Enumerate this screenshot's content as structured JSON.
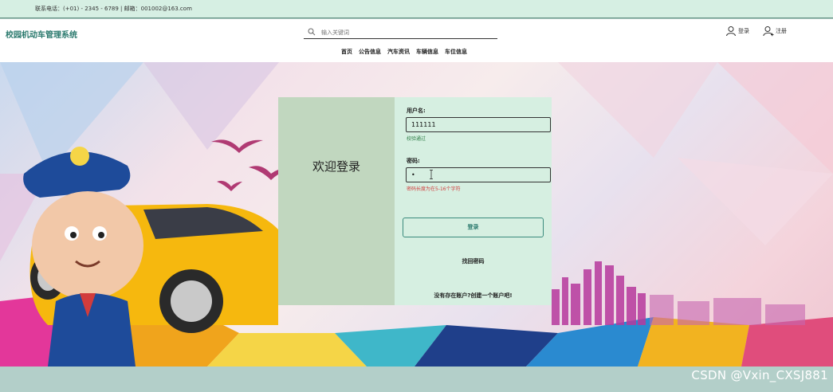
{
  "topbar": {
    "contact": "联系电话：(+01) - 2345 - 6789 | 邮箱：001002@163.com"
  },
  "header": {
    "brand": "校园机动车管理系统",
    "search_placeholder": "输入关键词",
    "login_label": "登录",
    "register_label": "注册"
  },
  "nav": {
    "items": [
      {
        "label": "首页"
      },
      {
        "label": "公告信息"
      },
      {
        "label": "汽车资讯"
      },
      {
        "label": "车辆信息"
      },
      {
        "label": "车位信息"
      }
    ]
  },
  "login_card": {
    "welcome": "欢迎登录",
    "username_label": "用户名:",
    "username_value": "111111",
    "username_hint": "校验通过",
    "password_label": "密码:",
    "password_value": "•",
    "password_hint": "密码长度为在5-16个字符",
    "submit_label": "登录",
    "forgot_label": "找回密码",
    "register_prompt": "没有存在账户?创建一个账户吧!"
  },
  "watermark": "CSDN @Vxin_CXSJ881",
  "colors": {
    "accent": "#2b7a6e",
    "card_left": "#c1d7bf",
    "card_right": "#d6efe1",
    "error": "#d23c3c",
    "ok": "#2e7d46"
  },
  "icons": [
    "search-icon",
    "user-icon",
    "user-plus-icon",
    "text-cursor-icon"
  ]
}
